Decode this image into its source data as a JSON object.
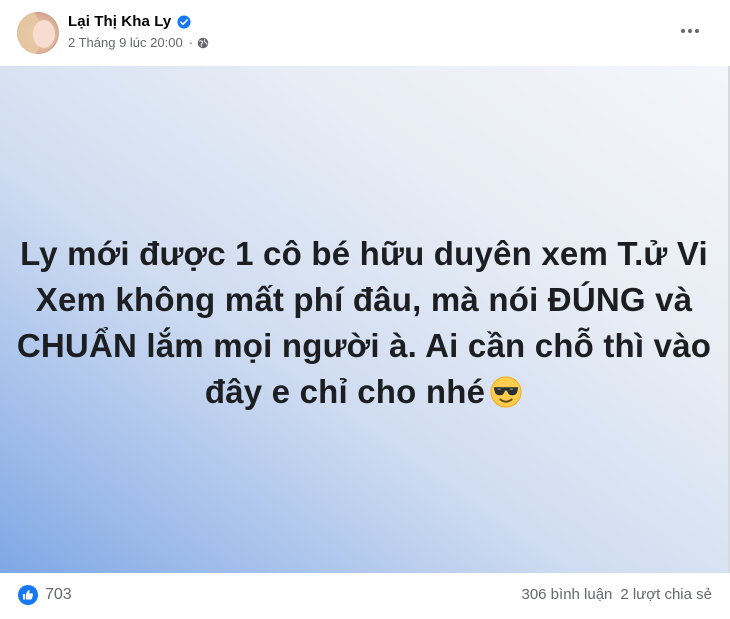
{
  "post": {
    "author": {
      "name": "Lại Thị Kha Ly",
      "verified": true
    },
    "timestamp": "2 Tháng 9 lúc 20:00",
    "privacy_icon": "globe-icon",
    "more_icon": "more-dots-icon",
    "content": {
      "lines": [
        "Ly mới được 1 cô bé hữu duyên xem T.ử Vi",
        "Xem không mất phí đâu, mà nói ĐÚNG và",
        "CHUẨN lắm mọi người à. Ai cần chỗ thì vào",
        "đây e chỉ cho nhé"
      ],
      "emoji": "smiling-face-with-sunglasses",
      "text_color": "#1c1e21",
      "background_gradient": [
        "#f4f6fa",
        "#cfdcf1",
        "#7fa7e5"
      ]
    },
    "reactions": {
      "icon": "like-icon",
      "count": "703"
    },
    "comments": "306 bình luận",
    "shares": "2 lượt chia sẻ"
  },
  "colors": {
    "accent": "#1877f2",
    "secondary_text": "#65676b"
  }
}
